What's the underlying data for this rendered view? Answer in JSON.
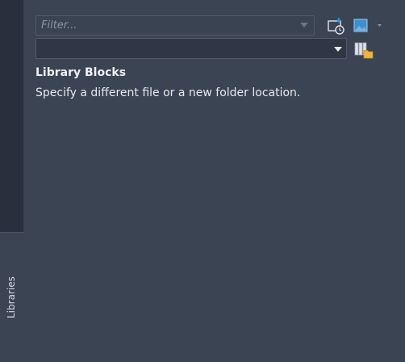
{
  "side_tab": {
    "label": "Libraries"
  },
  "toolbar": {
    "filter_placeholder": "Filter...",
    "filter_value": "",
    "path_value": "",
    "recent_icon": "recent-files-icon",
    "thumbnail_icon": "thumbnail-view-icon",
    "library_icon": "library-browse-icon"
  },
  "content": {
    "title": "Library Blocks",
    "description": "Specify a different file or a new folder location."
  },
  "colors": {
    "background": "#3b4453",
    "accent": "#1f9ee8",
    "folder": "#f2b53a"
  }
}
